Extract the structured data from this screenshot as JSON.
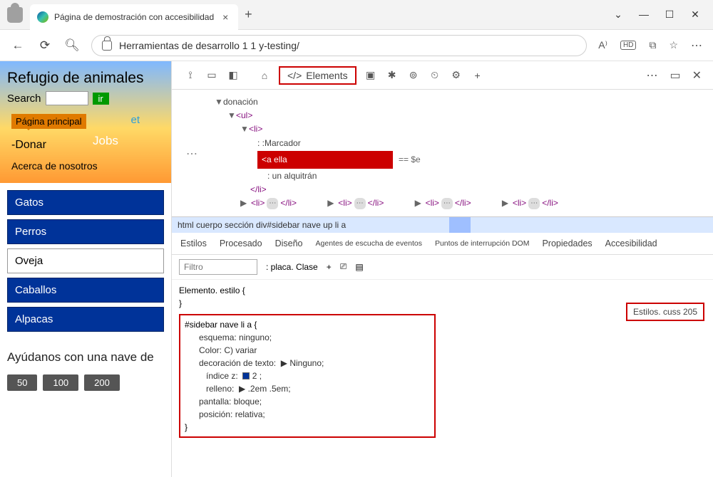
{
  "tab": {
    "title": "Página de demostración con accesibilidad"
  },
  "addressbar": {
    "url": "Herramientas de desarrollo 1 1 y-testing/"
  },
  "sidebar": {
    "title": "Refugio de animales",
    "search_label": "Search",
    "ir": "ir",
    "pagina_principal": "Página principal",
    "et": "et",
    "donar": "-Donar",
    "jobs": "Jobs",
    "acerca": "Acerca de nosotros",
    "items": [
      "Gatos",
      "Perros",
      "Oveja",
      "Caballos",
      "Alpacas"
    ],
    "help": "Ayúdanos con una nave de",
    "buttons": [
      "50",
      "100",
      "200"
    ]
  },
  "devtools": {
    "elements_label": "Elements",
    "dom": {
      "donacion": "donación",
      "ul_open": "<ul>",
      "li_open": "<li>",
      "marker": ": :Marcador",
      "a_ella": "<a ella",
      "eq": "== $e",
      "alquitran": ": un alquitrán",
      "li_close": "</li>",
      "li_coll_open": "<li>",
      "li_coll_close": "</li>"
    },
    "breadcrumb": "html cuerpo sección div#sidebar nave up li a",
    "tabs": {
      "estilos": "Estilos",
      "procesado": "Procesado",
      "diseno": "Diseño",
      "agentes": "Agentes de escucha de eventos",
      "puntos": "Puntos de interrupción DOM",
      "propiedades": "Propiedades",
      "accesibilidad": "Accesibilidad"
    },
    "filter_placeholder": "Filtro",
    "placa_clase": ": placa. Clase",
    "element_style": "Elemento. estilo {",
    "rule_selector": "#sidebar nave li a {",
    "props": {
      "esquema": "esquema: ninguno;",
      "color": "Color:      C) variar",
      "deco_label": "decoración de texto:",
      "deco_val": "Ninguno;",
      "z_label": "índice z:",
      "z_val": "2 ;",
      "relleno_label": "relleno:",
      "relleno_val": ".2em .5em;",
      "pantalla": "pantalla: bloque;",
      "posicion": "posición: relativa;"
    },
    "source_link": "Estilos. cuss 205"
  }
}
